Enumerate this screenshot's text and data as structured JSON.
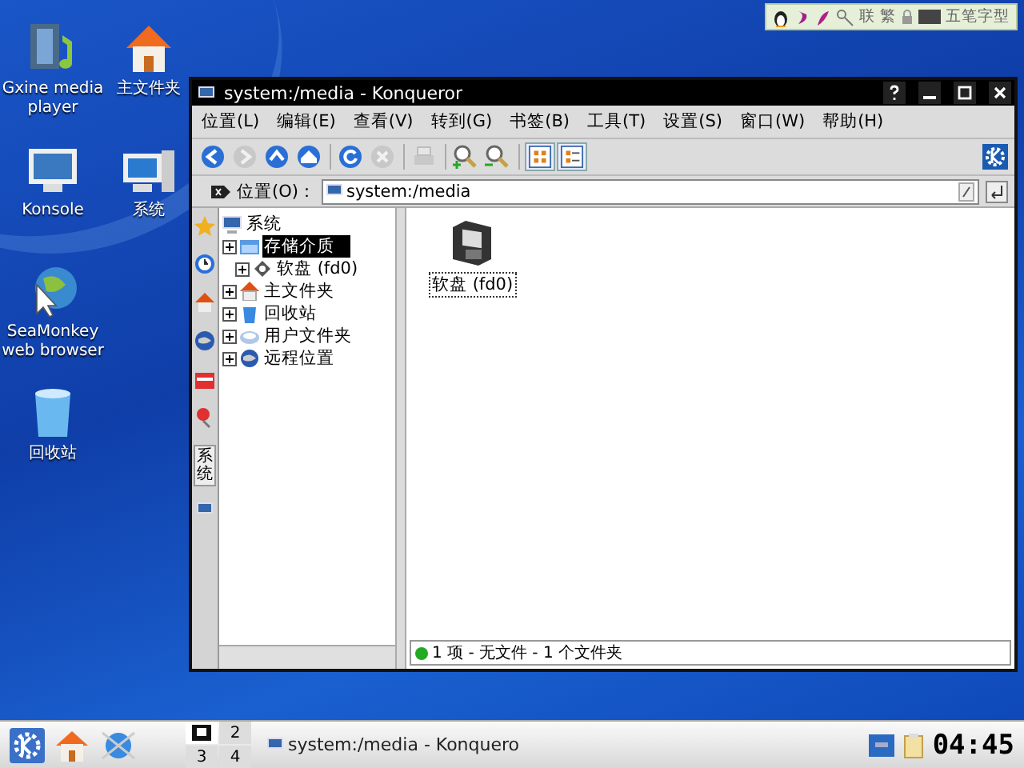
{
  "desktop_columns": [
    {
      "icons": [
        {
          "label": "Gxine media player",
          "kind": "media"
        },
        {
          "label": "Konsole",
          "kind": "terminal"
        },
        {
          "label": "SeaMonkey web browser",
          "kind": "globe"
        },
        {
          "label": "回收站",
          "kind": "trash"
        }
      ]
    },
    {
      "icons": [
        {
          "label": "主文件夹",
          "kind": "home"
        },
        {
          "label": "系统",
          "kind": "computer"
        }
      ]
    }
  ],
  "tray_top": {
    "texts": [
      "联",
      "繁",
      "五笔字型"
    ]
  },
  "window": {
    "title": "system:/media - Konqueror",
    "menu": [
      "位置(L)",
      "编辑(E)",
      "查看(V)",
      "转到(G)",
      "书签(B)",
      "工具(T)",
      "设置(S)",
      "窗口(W)",
      "帮助(H)"
    ],
    "toolbar": [
      {
        "kind": "back",
        "disabled": false
      },
      {
        "kind": "forward",
        "disabled": true
      },
      {
        "kind": "up",
        "disabled": false
      },
      {
        "kind": "home",
        "disabled": false
      },
      {
        "kind": "reload",
        "disabled": false
      },
      {
        "kind": "stop",
        "disabled": true
      },
      {
        "kind": "print",
        "disabled": true
      },
      {
        "kind": "zoom-in",
        "disabled": false
      },
      {
        "kind": "zoom-out",
        "disabled": false
      },
      {
        "kind": "icon-view",
        "disabled": false
      },
      {
        "kind": "list-view",
        "disabled": false
      }
    ],
    "location": {
      "label": "位置(O)：",
      "value": "system:/media"
    },
    "sidebar_tab": "系统",
    "tree": {
      "label": "系统",
      "children": [
        {
          "label": "存储介质",
          "kind": "media",
          "selected": true,
          "children": [
            {
              "label": "软盘 (fd0)",
              "kind": "floppy",
              "selected": false
            }
          ]
        },
        {
          "label": "主文件夹",
          "kind": "home",
          "selected": false
        },
        {
          "label": "回收站",
          "kind": "trash",
          "selected": false
        },
        {
          "label": "用户文件夹",
          "kind": "users",
          "selected": false
        },
        {
          "label": "远程位置",
          "kind": "remote",
          "selected": false
        }
      ]
    },
    "files": [
      {
        "label": "软盘 (fd0)",
        "kind": "floppy"
      }
    ],
    "status": "1 项 - 无文件 - 1 个文件夹"
  },
  "taskbar": {
    "desktops": [
      {
        "selected": true
      },
      {
        "label": "2",
        "selected": false
      },
      {
        "label": "3",
        "selected": false
      },
      {
        "label": "4",
        "selected": false
      }
    ],
    "task": "system:/media - Konquero",
    "clock": "04:45"
  }
}
